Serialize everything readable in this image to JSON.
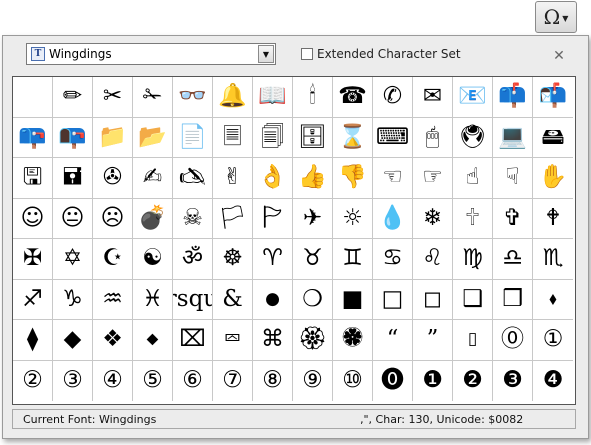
{
  "toolbar": {
    "symbol_button": "Ω"
  },
  "font_selector": {
    "value": "Wingdings"
  },
  "extended_charset": {
    "label": "Extended Character Set",
    "checked": false
  },
  "close_label": "✕",
  "glyphs": [
    "",
    "✏",
    "✂",
    "✁",
    "👓",
    "🔔",
    "📖",
    "🕯",
    "☎",
    "✆",
    "✉",
    "📧",
    "📫",
    "📬",
    "📪",
    "📭",
    "📁",
    "📂",
    "📄",
    "🗏",
    "🗐",
    "🗄",
    "⌛",
    "⌨",
    "🖱",
    "🖲",
    "💻",
    "🖴",
    "🖫",
    "🖬",
    "✇",
    "✍",
    "🖎",
    "✌",
    "👌",
    "👍",
    "👎",
    "☜",
    "☞",
    "☝",
    "☟",
    "✋",
    "☺",
    "😐",
    "☹",
    "💣",
    "☠",
    "🏳",
    "🏱",
    "✈",
    "☼",
    "💧",
    "❄",
    "🕆",
    "✞",
    "🕈",
    "✠",
    "✡",
    "☪",
    "☯",
    "ॐ",
    "☸",
    "♈",
    "♉",
    "♊",
    "♋",
    "♌",
    "♍",
    "♎",
    "♏",
    "♐",
    "♑",
    "♒",
    "♓",
    "&rsquo;",
    "&",
    "●",
    "❍",
    "■",
    "□",
    "◻",
    "❑",
    "❒",
    "⬧",
    "⧫",
    "◆",
    "❖",
    "⬥",
    "⌧",
    "⮹",
    "⌘",
    "🏵",
    "🏶",
    "“",
    "”",
    "▯",
    "⓪",
    "①",
    "②",
    "③",
    "④",
    "⑤",
    "⑥",
    "⑦",
    "⑧",
    "⑨",
    "⑩",
    "⓿",
    "❶",
    "❷",
    "❸",
    "❹"
  ],
  "status": {
    "current_font": "Current Font: Wingdings",
    "char_info": "‚\", Char: 130, Unicode: $0082"
  }
}
